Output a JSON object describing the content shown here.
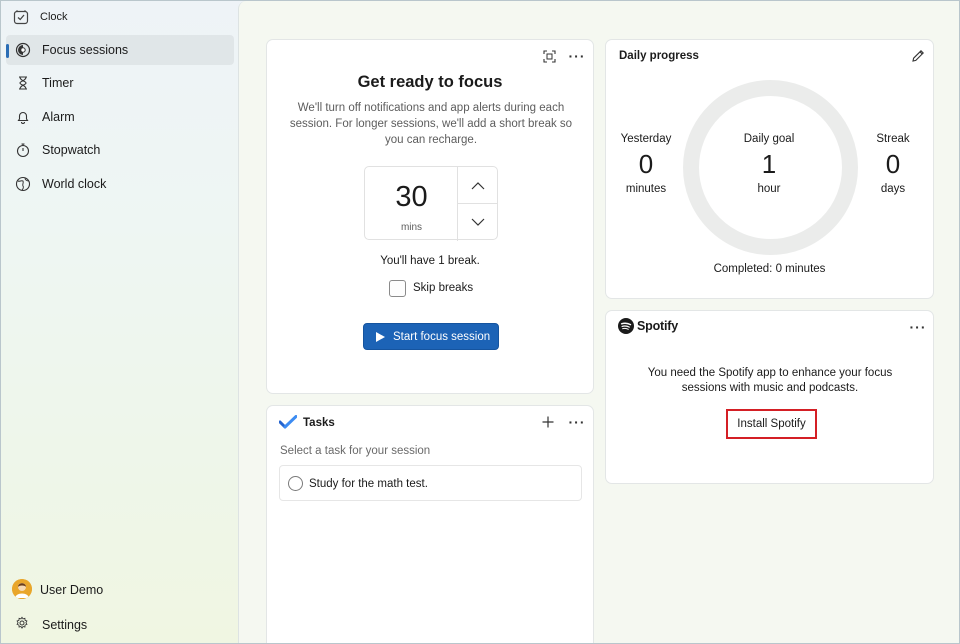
{
  "window": {
    "title": "Clock"
  },
  "sidebar": {
    "items": [
      {
        "label": "Focus sessions",
        "icon": "focus-icon",
        "active": true
      },
      {
        "label": "Timer",
        "icon": "hourglass-icon"
      },
      {
        "label": "Alarm",
        "icon": "bell-icon"
      },
      {
        "label": "Stopwatch",
        "icon": "stopwatch-icon"
      },
      {
        "label": "World clock",
        "icon": "globe-icon"
      }
    ],
    "user": {
      "name": "User Demo"
    },
    "settings_label": "Settings"
  },
  "focus": {
    "title": "Get ready to focus",
    "description": "We'll turn off notifications and app alerts during each session. For longer sessions, we'll add a short break so you can recharge.",
    "duration_value": "30",
    "duration_unit": "mins",
    "break_text": "You'll have 1 break.",
    "skip_breaks_label": "Skip breaks",
    "skip_breaks_checked": false,
    "start_label": "Start focus session"
  },
  "daily_progress": {
    "title": "Daily progress",
    "yesterday": {
      "caption": "Yesterday",
      "value": "0",
      "unit": "minutes"
    },
    "goal": {
      "caption": "Daily goal",
      "value": "1",
      "unit": "hour"
    },
    "streak": {
      "caption": "Streak",
      "value": "0",
      "unit": "days"
    },
    "completed": "Completed: 0 minutes"
  },
  "spotify": {
    "brand": "Spotify",
    "message": "You need the Spotify app to enhance your focus sessions with music and podcasts.",
    "install_label": "Install Spotify"
  },
  "tasks": {
    "title": "Tasks",
    "hint": "Select a task for your session",
    "items": [
      {
        "label": "Study for the math test."
      }
    ]
  },
  "colors": {
    "accent": "#1c63b6",
    "highlight": "#d41f25",
    "spotify": "#1b1b1b"
  }
}
